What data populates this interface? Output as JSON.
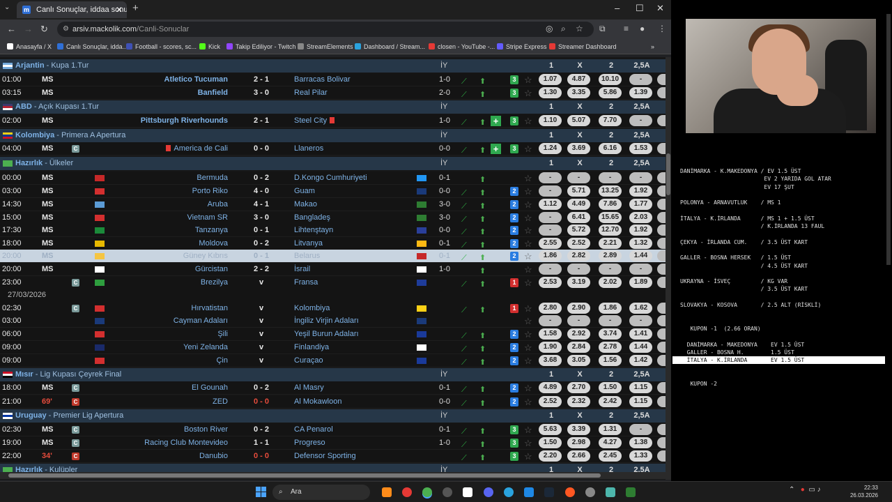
{
  "browser": {
    "tab_title": "Canlı Sonuçlar, iddaa sonuçları",
    "tab_favicon": "m",
    "url_host": "arsiv.mackolik.com",
    "url_path": "/Canli-Sonuclar",
    "bookmarks": [
      "Anasayfa / X",
      "Canlı Sonuçlar, idda...",
      "Football - scores, sc...",
      "Kick",
      "Takip Ediliyor - Twitch",
      "StreamElements",
      "Dashboard / Stream...",
      "closen - YouTube -...",
      "Stripe Express",
      "Streamer Dashboard"
    ]
  },
  "colors": {
    "league_bar": "#263748",
    "team_link": "#7eb2e6",
    "green_badge": "#2fa84f",
    "blue_badge": "#2a7de1",
    "red": "#e74c3c"
  },
  "header_cols": {
    "iy": "İY",
    "c1": "1",
    "cx": "X",
    "c2": "2",
    "ou": "2,5A",
    "extra": "2"
  },
  "blocks": [
    {
      "kind": "league",
      "country": "Arjantin",
      "name": "Kupa 1.Tur",
      "flag": [
        "#75aadb",
        "#fff",
        "#75aadb"
      ]
    },
    {
      "kind": "match",
      "time": "01:00",
      "status": "MS",
      "home": "Atletico Tucuman",
      "home_bold": true,
      "score": "2 - 1",
      "away": "Barracas Bolivar",
      "ht": "1-0",
      "cnt": "3",
      "cntc": "g",
      "odds": [
        "1.07",
        "4.87",
        "10.10",
        "-"
      ]
    },
    {
      "kind": "match",
      "time": "03:15",
      "status": "MS",
      "home": "Banfield",
      "home_bold": true,
      "score": "3 - 0",
      "away": "Real Pilar",
      "ht": "2-0",
      "cnt": "3",
      "cntc": "g",
      "odds": [
        "1.30",
        "3.35",
        "5.86",
        "1.39"
      ]
    },
    {
      "kind": "league",
      "country": "ABD",
      "name": "Açık Kupası 1.Tur",
      "flag": [
        "#3c3b6e",
        "#b22234",
        "#fff"
      ]
    },
    {
      "kind": "match",
      "time": "02:00",
      "status": "MS",
      "home": "Pittsburgh Riverhounds",
      "home_bold": true,
      "score": "2 - 1",
      "away": "Steel City",
      "away_card": true,
      "ht": "1-0",
      "plus": true,
      "cnt": "3",
      "cntc": "g",
      "odds": [
        "1.10",
        "5.07",
        "7.70",
        "-"
      ]
    },
    {
      "kind": "league",
      "country": "Kolombiya",
      "name": "Primera A Apertura",
      "flag": [
        "#fcd116",
        "#003893",
        "#ce1126"
      ]
    },
    {
      "kind": "match",
      "time": "04:00",
      "status": "MS",
      "badge": "C",
      "home": "America de Cali",
      "home_card": true,
      "score": "0 - 0",
      "away": "Llaneros",
      "ht": "0-0",
      "plus": true,
      "cnt": "3",
      "cntc": "g",
      "odds": [
        "1.24",
        "3.69",
        "6.16",
        "1.53"
      ]
    },
    {
      "kind": "league",
      "country": "Hazırlık",
      "name": "Ülkeler",
      "flag": [
        "#4caf50",
        "#4caf50",
        "#4caf50"
      ],
      "dim_header": true
    },
    {
      "kind": "match",
      "time": "00:00",
      "status": "MS",
      "fh": "#c62828",
      "home": "Bermuda",
      "score": "0 - 2",
      "away": "D.Kongo Cumhuriyeti",
      "fa": "#2196f3",
      "ht": "0-1",
      "noc": true,
      "odds": [
        "-",
        "-",
        "-",
        "-"
      ]
    },
    {
      "kind": "match",
      "time": "03:00",
      "status": "MS",
      "fh": "#d32f2f",
      "home": "Porto Riko",
      "score": "4 - 0",
      "away": "Guam",
      "fa": "#1a3a7a",
      "ht": "0-0",
      "cnt": "2",
      "cntc": "b",
      "odds": [
        "-",
        "5.71",
        "13.25",
        "1.92"
      ]
    },
    {
      "kind": "match",
      "time": "14:30",
      "status": "MS",
      "fh": "#5b9bd5",
      "home": "Aruba",
      "score": "4 - 1",
      "away": "Makao",
      "fa": "#2e7d32",
      "ht": "3-0",
      "cnt": "2",
      "cntc": "b",
      "odds": [
        "1.12",
        "4.49",
        "7.86",
        "1.77"
      ]
    },
    {
      "kind": "match",
      "time": "15:00",
      "status": "MS",
      "fh": "#d32f2f",
      "home": "Vietnam SR",
      "score": "3 - 0",
      "away": "Bangladeş",
      "fa": "#2e7d32",
      "ht": "3-0",
      "cnt": "2",
      "cntc": "b",
      "odds": [
        "-",
        "6.41",
        "15.65",
        "2.03"
      ]
    },
    {
      "kind": "match",
      "time": "17:30",
      "status": "MS",
      "fh": "#1b8a3a",
      "home": "Tanzanya",
      "score": "0 - 1",
      "away": "Lihtenştayn",
      "fa": "#2a3f9a",
      "ht": "0-0",
      "cnt": "2",
      "cntc": "b",
      "odds": [
        "-",
        "5.72",
        "12.70",
        "1.92"
      ]
    },
    {
      "kind": "match",
      "time": "18:00",
      "status": "MS",
      "fh": "#e6b800",
      "home": "Moldova",
      "score": "0 - 2",
      "away": "Litvanya",
      "fa": "#fdb913",
      "ht": "0-1",
      "cnt": "2",
      "cntc": "b",
      "odds": [
        "2.55",
        "2.52",
        "2.21",
        "1.32"
      ]
    },
    {
      "kind": "match",
      "time": "20:00",
      "status": "MS",
      "fh": "#f5c542",
      "home": "Güney Kıbrıs",
      "score": "0 - 1",
      "away": "Belarus",
      "fa": "#c62828",
      "ht": "0-1",
      "cnt": "2",
      "cntc": "b",
      "highlight": true,
      "odds": [
        "1.86",
        "2.82",
        "2.89",
        "1.44"
      ]
    },
    {
      "kind": "match",
      "time": "20:00",
      "status": "MS",
      "fh": "#ffffff",
      "home": "Gürcistan",
      "score": "2 - 2",
      "away": "İsrail",
      "fa": "#ffffff",
      "ht": "1-0",
      "noc": true,
      "odds": [
        "-",
        "-",
        "-",
        "-"
      ]
    },
    {
      "kind": "match",
      "time": "23:00",
      "status": "",
      "badge": "C",
      "fh": "#2e9e3e",
      "home": "Brezilya",
      "score": "v",
      "away": "Fransa",
      "fa": "#1e3c9a",
      "ht": "",
      "cnt": "1",
      "cntc": "r",
      "odds": [
        "2.53",
        "3.19",
        "2.02",
        "1.89"
      ]
    },
    {
      "kind": "date",
      "text": "27/03/2026"
    },
    {
      "kind": "match",
      "time": "02:30",
      "status": "",
      "badge": "C",
      "fh": "#d32f2f",
      "home": "Hırvatistan",
      "score": "v",
      "away": "Kolombiya",
      "fa": "#fcd116",
      "ht": "",
      "cnt": "1",
      "cntc": "r",
      "odds": [
        "2.80",
        "2.90",
        "1.86",
        "1.62"
      ]
    },
    {
      "kind": "match",
      "time": "03:00",
      "status": "",
      "fh": "#1a3a7a",
      "home": "Cayman Adaları",
      "score": "v",
      "away": "İngiliz Virjin Adaları",
      "fa": "#1a3a7a",
      "ht": "",
      "noicons": true,
      "odds": [
        "-",
        "-",
        "-",
        "-"
      ]
    },
    {
      "kind": "match",
      "time": "06:00",
      "status": "",
      "fh": "#d32f2f",
      "home": "Şili",
      "score": "v",
      "away": "Yeşil Burun Adaları",
      "fa": "#1a3a9a",
      "ht": "",
      "cnt": "2",
      "cntc": "b",
      "odds": [
        "1.58",
        "2.92",
        "3.74",
        "1.41"
      ]
    },
    {
      "kind": "match",
      "time": "09:00",
      "status": "",
      "fh": "#1a2a6a",
      "home": "Yeni Zelanda",
      "score": "v",
      "away": "Finlandiya",
      "fa": "#ffffff",
      "ht": "",
      "cnt": "2",
      "cntc": "b",
      "odds": [
        "1.90",
        "2.84",
        "2.78",
        "1.44"
      ]
    },
    {
      "kind": "match",
      "time": "09:00",
      "status": "",
      "fh": "#d32f2f",
      "home": "Çin",
      "score": "v",
      "away": "Curaçao",
      "fa": "#1a3a9a",
      "ht": "",
      "cnt": "2",
      "cntc": "b",
      "odds": [
        "3.68",
        "3.05",
        "1.56",
        "1.42"
      ]
    },
    {
      "kind": "league",
      "country": "Mısır",
      "name": "Lig Kupası Çeyrek Final",
      "flag": [
        "#ce1126",
        "#fff",
        "#000"
      ]
    },
    {
      "kind": "match",
      "time": "18:00",
      "status": "MS",
      "badge": "C",
      "home": "El Gounah",
      "score": "0 - 2",
      "away": "Al Masry",
      "ht": "0-1",
      "cnt": "2",
      "cntc": "b",
      "odds": [
        "4.89",
        "2.70",
        "1.50",
        "1.15"
      ]
    },
    {
      "kind": "match",
      "time": "21:00",
      "status": "69'",
      "live": true,
      "badge": "C",
      "badge_red": true,
      "home": "ZED",
      "score": "0 - 0",
      "score_red": true,
      "away": "Al Mokawloon",
      "ht": "0-0",
      "cnt": "2",
      "cntc": "b",
      "odds": [
        "2.52",
        "2.32",
        "2.42",
        "1.15"
      ]
    },
    {
      "kind": "league",
      "country": "Uruguay",
      "name": "Premier Lig Apertura",
      "flag": [
        "#fff",
        "#0038a8",
        "#fff"
      ]
    },
    {
      "kind": "match",
      "time": "02:30",
      "status": "MS",
      "badge": "C",
      "home": "Boston River",
      "score": "0 - 2",
      "away": "CA Penarol",
      "ht": "0-1",
      "cnt": "3",
      "cntc": "g",
      "odds": [
        "5.63",
        "3.39",
        "1.31",
        "-"
      ]
    },
    {
      "kind": "match",
      "time": "19:00",
      "status": "MS",
      "badge": "C",
      "home": "Racing Club Montevideo",
      "score": "1 - 1",
      "away": "Progreso",
      "ht": "1-0",
      "cnt": "3",
      "cntc": "g",
      "odds": [
        "1.50",
        "2.98",
        "4.27",
        "1.38"
      ]
    },
    {
      "kind": "match",
      "time": "22:00",
      "status": "34'",
      "live": true,
      "badge": "C",
      "badge_red": true,
      "home": "Danubio",
      "score": "0 - 0",
      "score_red": true,
      "away": "Defensor Sporting",
      "ht": "",
      "cnt": "3",
      "cntc": "g",
      "odds": [
        "2.20",
        "2.66",
        "2.45",
        "1.33"
      ]
    },
    {
      "kind": "league",
      "country": "Hazırlık",
      "name": "Kulüpler",
      "flag": [
        "#4caf50",
        "#4caf50",
        "#4caf50"
      ]
    }
  ],
  "notes": [
    "DANİMARKA - K.MAKEDONYA / EV 1.5 ÜST",
    "                         EV 2 YARIDA GOL ATAR",
    "                         EV 17 ŞUT",
    "",
    "POLONYA - ARNAVUTLUK    / MS 1",
    "",
    "İTALYA - K.İRLANDA      / MS 1 + 1.5 ÜST",
    "                        / K.İRLANDA 13 FAUL",
    "",
    "ÇEKYA - İRLANDA CUM.    / 3.5 ÜST KART",
    "",
    "GALLER - BOSNA HERSEK   / 1.5 ÜST",
    "                        / 4.5 ÜST KART",
    "",
    "UKRAYNA - İSVEÇ         / KG VAR",
    "                        / 3.5 ÜST KART",
    "",
    "SLOVAKYA - KOSOVA       / 2.5 ALT (RİSKLİ)",
    "",
    "",
    "   KUPON -1  (2.66 ORAN)",
    "",
    "  DANİMARKA - MAKEDONYA    EV 1.5 ÜST",
    "  GALLER - BOSNA H.        1.5 ÜST",
    "  İTALYA - K.İRLANDA       EV 1.5 ÜST",
    "",
    "",
    "   KUPON -2"
  ],
  "notes_highlight_index": 24,
  "taskbar": {
    "search": "Ara",
    "time": "22:33",
    "date": "26.03.2026"
  }
}
